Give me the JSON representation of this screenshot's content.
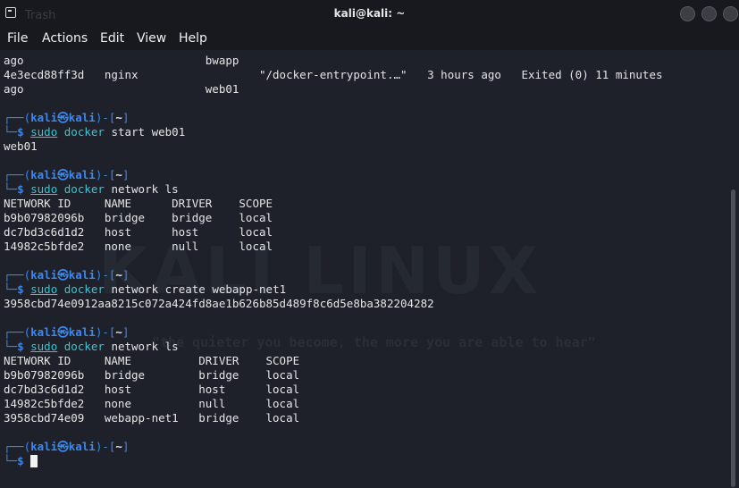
{
  "window": {
    "title": "kali@kali: ~",
    "ghost_label": "Trash"
  },
  "menu": [
    "File",
    "Actions",
    "Edit",
    "View",
    "Help"
  ],
  "prompt": {
    "open": "┌──(",
    "user": "kali",
    "at": "㉿",
    "host": "kali",
    "mid": ")-[",
    "path": "~",
    "close": "]",
    "second": "└─",
    "dollar": "$ "
  },
  "lines": {
    "l01": "ago                           bwapp",
    "l02": "4e3ecd88ff3d   nginx                  \"/docker-entrypoint.…\"   3 hours ago   Exited (0) 11 minutes",
    "l03": "ago                           web01",
    "c1_sudo": "sudo",
    "c1_docker": "docker",
    "c1_rest": " start web01",
    "o1": "web01",
    "c2_sudo": "sudo",
    "c2_docker": "docker",
    "c2_rest": " network ls",
    "t1_h": "NETWORK ID     NAME      DRIVER    SCOPE",
    "t1_r1": "b9b07982096b   bridge    bridge    local",
    "t1_r2": "dc7bd3c6d1d2   host      host      local",
    "t1_r3": "14982c5bfde2   none      null      local",
    "c3_sudo": "sudo",
    "c3_docker": "docker",
    "c3_rest": " network create webapp-net1",
    "o3": "3958cbd74e0912aa8215c072a424fd8ae1b626b85d489f8c6d5e8ba382204282",
    "c4_sudo": "sudo",
    "c4_docker": "docker",
    "c4_rest": " network ls",
    "t2_h": "NETWORK ID     NAME          DRIVER    SCOPE",
    "t2_r1": "b9b07982096b   bridge        bridge    local",
    "t2_r2": "dc7bd3c6d1d2   host          host      local",
    "t2_r3": "14982c5bfde2   none          null      local",
    "t2_r4": "3958cbd74e09   webapp-net1   bridge    local"
  },
  "watermark": {
    "logo": "KALI LINUX",
    "quote": "\"the quieter you become, the more you are able to hear\""
  },
  "colors": {
    "prompt_blue": "#3a88f2",
    "command_cyan": "#3ec1d3",
    "text": "#e5e5e5",
    "background": "#1e2129"
  }
}
